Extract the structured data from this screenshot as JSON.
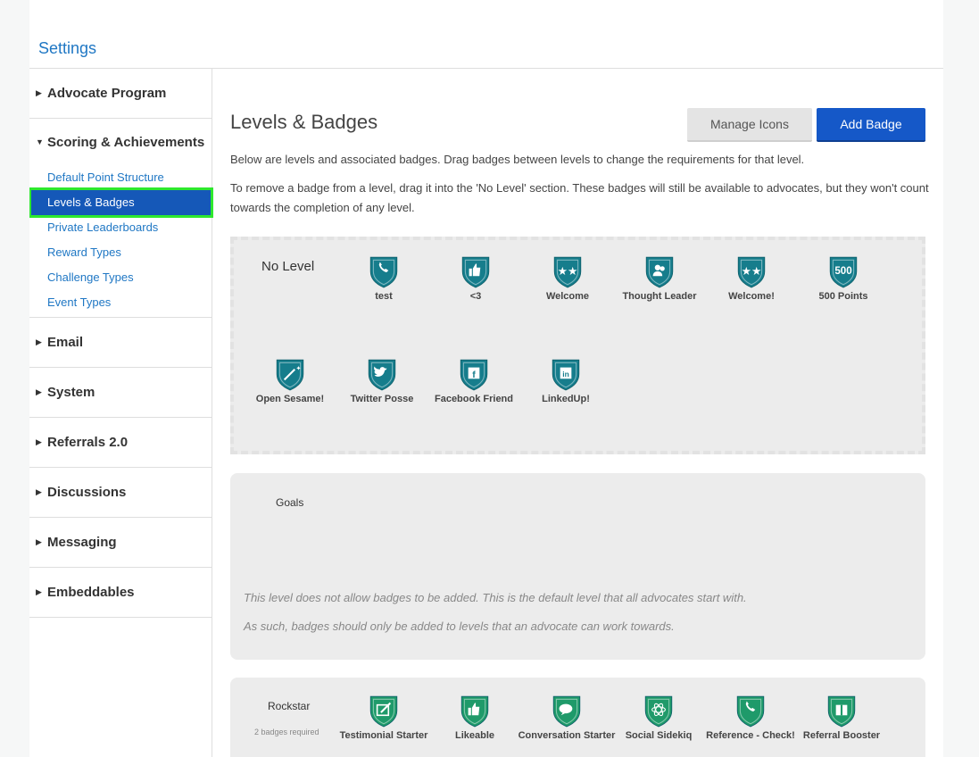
{
  "header": {
    "title": "Settings"
  },
  "sidebar": {
    "sections": [
      {
        "label": "Advocate Program"
      },
      {
        "label": "Scoring & Achievements",
        "items": [
          {
            "label": "Default Point Structure"
          },
          {
            "label": "Levels & Badges"
          },
          {
            "label": "Private Leaderboards"
          },
          {
            "label": "Reward Types"
          },
          {
            "label": "Challenge Types"
          },
          {
            "label": "Event Types"
          }
        ]
      },
      {
        "label": "Email"
      },
      {
        "label": "System"
      },
      {
        "label": "Referrals 2.0"
      },
      {
        "label": "Discussions"
      },
      {
        "label": "Messaging"
      },
      {
        "label": "Embeddables"
      }
    ]
  },
  "main": {
    "title": "Levels & Badges",
    "manage_icons": "Manage Icons",
    "add_badge": "Add Badge",
    "desc1": "Below are levels and associated badges. Drag badges between levels to change the requirements for that level.",
    "desc2": "To remove a badge from a level, drag it into the 'No Level' section. These badges will still be available to advocates, but they won't count towards the completion of any level.",
    "no_level": {
      "name": "No Level",
      "badges": [
        {
          "label": "test",
          "icon": "phone-icon"
        },
        {
          "label": "<3",
          "icon": "thumbs-up-icon"
        },
        {
          "label": "Welcome",
          "icon": "stars-icon"
        },
        {
          "label": "Thought Leader",
          "icon": "people-icon"
        },
        {
          "label": "Welcome!",
          "icon": "stars-icon"
        },
        {
          "label": "500 Points",
          "icon": "500-icon"
        },
        {
          "label": "Open Sesame!",
          "icon": "magic-wand-icon"
        },
        {
          "label": "Twitter Posse",
          "icon": "twitter-icon"
        },
        {
          "label": "Facebook Friend",
          "icon": "facebook-icon"
        },
        {
          "label": "LinkedUp!",
          "icon": "linkedin-icon"
        }
      ]
    },
    "goals": {
      "name": "Goals",
      "note1": "This level does not allow badges to be added. This is the default level that all advocates start with.",
      "note2": "As such, badges should only be added to levels that an advocate can work towards."
    },
    "rockstar": {
      "name": "Rockstar",
      "required": "2 badges required",
      "badges": [
        {
          "label": "Testimonial Starter",
          "icon": "pencil-icon"
        },
        {
          "label": "Likeable",
          "icon": "thumbs-up-icon"
        },
        {
          "label": "Conversation Starter",
          "icon": "chat-icon"
        },
        {
          "label": "Social Sidekiq",
          "icon": "atom-icon"
        },
        {
          "label": "Reference - Check!",
          "icon": "phone-icon"
        },
        {
          "label": "Referral Booster",
          "icon": "gift-icon"
        }
      ]
    }
  },
  "colors": {
    "link": "#1f77c4",
    "primary_button": "#1558c8",
    "active_nav": "#1558b8",
    "active_outline": "#2ee82e",
    "badge_teal": "#167d8c",
    "badge_green": "#1f9a6a"
  }
}
